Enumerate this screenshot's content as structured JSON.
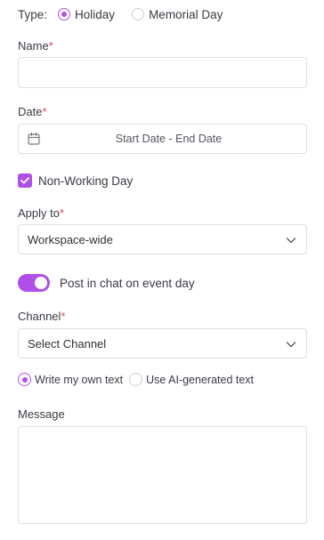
{
  "type": {
    "label": "Type:",
    "options": [
      "Holiday",
      "Memorial Day"
    ],
    "selected": "Holiday"
  },
  "name": {
    "label": "Name",
    "required_mark": "*",
    "value": "",
    "placeholder": ""
  },
  "date": {
    "label": "Date",
    "required_mark": "*",
    "placeholder": "Start Date - End Date",
    "icon": "calendar-icon"
  },
  "non_working_day": {
    "label": "Non-Working Day",
    "checked": true
  },
  "apply_to": {
    "label": "Apply to",
    "required_mark": "*",
    "selected": "Workspace-wide",
    "icon": "chevron-down-icon"
  },
  "post_in_chat": {
    "label": "Post in chat on event day",
    "enabled": true
  },
  "channel": {
    "label": "Channel",
    "required_mark": "*",
    "selected": "Select Channel",
    "icon": "chevron-down-icon"
  },
  "text_mode": {
    "options": [
      "Write my own text",
      "Use AI-generated text"
    ],
    "selected": "Write my own text"
  },
  "message": {
    "label": "Message",
    "value": "",
    "placeholder": ""
  },
  "colors": {
    "accent": "#b04ee8",
    "required": "#e0455a",
    "border": "#dedfe4",
    "text": "#3a3a44"
  }
}
